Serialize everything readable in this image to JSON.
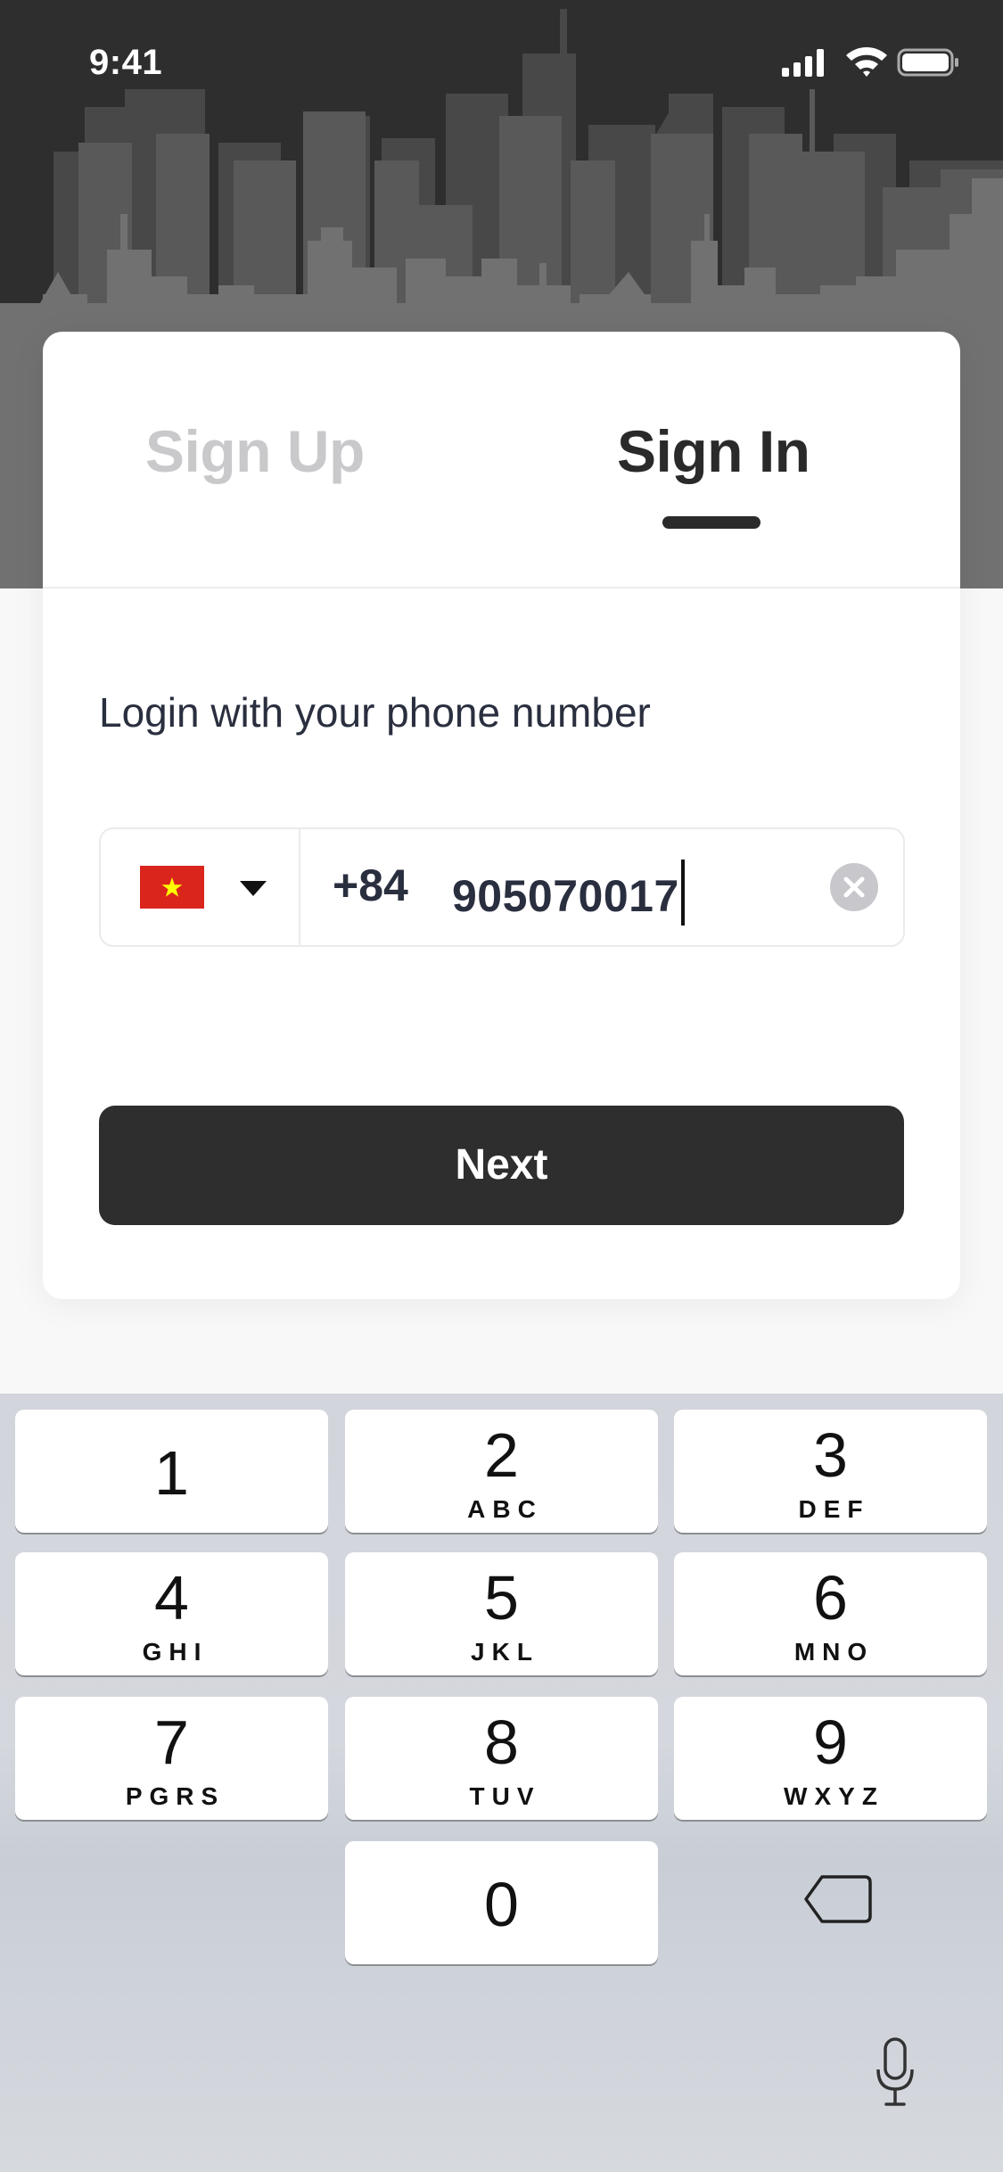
{
  "status_bar": {
    "time": "9:41",
    "icons": [
      "signal-icon",
      "wifi-icon",
      "battery-icon"
    ]
  },
  "tabs": [
    {
      "label": "Sign Up",
      "active": false
    },
    {
      "label": "Sign In",
      "active": true
    }
  ],
  "login": {
    "subtitle": "Login with your phone number",
    "country_flag": "vietnam-flag-icon",
    "dial_code": "+84",
    "phone_value": "905070017",
    "next_label": "Next"
  },
  "keypad": {
    "keys": [
      {
        "digit": "1",
        "letters": ""
      },
      {
        "digit": "2",
        "letters": "ABC"
      },
      {
        "digit": "3",
        "letters": "DEF"
      },
      {
        "digit": "4",
        "letters": "GHI"
      },
      {
        "digit": "5",
        "letters": "JKL"
      },
      {
        "digit": "6",
        "letters": "MNO"
      },
      {
        "digit": "7",
        "letters": "PGRS"
      },
      {
        "digit": "8",
        "letters": "TUV"
      },
      {
        "digit": "9",
        "letters": "WXYZ"
      },
      {
        "digit": "0",
        "letters": ""
      }
    ],
    "icons": [
      "backspace-icon",
      "microphone-icon"
    ]
  },
  "colors": {
    "dark": "#2e2e2e",
    "inactive_tab": "#c9c9cc",
    "text": "#2a2f3f",
    "flag_red": "#da251d",
    "flag_star": "#ffff00"
  }
}
